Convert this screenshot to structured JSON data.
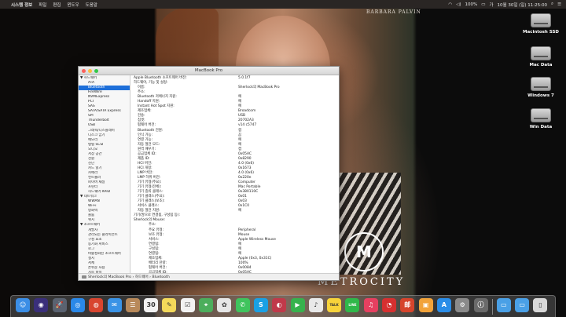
{
  "menubar": {
    "apple": "",
    "app_name": "시스템 정보",
    "menus": [
      "파일",
      "편집",
      "윈도우",
      "도움말"
    ],
    "battery": "100%",
    "datetime": "10월 30일 (일) 11:25:00"
  },
  "wallpaper": {
    "brand_text": "BARBARA PALVIN",
    "logo_text": "METROCITY",
    "logo_mark": "M"
  },
  "desktop_icons": [
    {
      "label": "Macintosh SSD"
    },
    {
      "label": "Mac Data"
    },
    {
      "label": "Windows 7"
    },
    {
      "label": "Win Data"
    }
  ],
  "window": {
    "title": "MacBook Pro",
    "sidebar": [
      {
        "label": "▼ 하드웨어",
        "type": "section"
      },
      {
        "label": "ATA",
        "type": "child"
      },
      {
        "label": "Bluetooth",
        "type": "child",
        "selected": true
      },
      {
        "label": "FireWire",
        "type": "child"
      },
      {
        "label": "NVMExpress",
        "type": "child"
      },
      {
        "label": "PCI",
        "type": "child"
      },
      {
        "label": "SAS",
        "type": "child"
      },
      {
        "label": "SATA/SATA Express",
        "type": "child"
      },
      {
        "label": "SPI",
        "type": "child"
      },
      {
        "label": "Thunderbolt",
        "type": "child"
      },
      {
        "label": "USB",
        "type": "child"
      },
      {
        "label": "그래픽/디스플레이",
        "type": "child"
      },
      {
        "label": "디스크 굽기",
        "type": "child"
      },
      {
        "label": "메모리",
        "type": "child"
      },
      {
        "label": "병렬 SCSI",
        "type": "child"
      },
      {
        "label": "오디오",
        "type": "child"
      },
      {
        "label": "저장 공간",
        "type": "child"
      },
      {
        "label": "전원",
        "type": "child"
      },
      {
        "label": "진단",
        "type": "child"
      },
      {
        "label": "카드 읽기",
        "type": "child"
      },
      {
        "label": "카메라",
        "type": "child"
      },
      {
        "label": "컨트롤러",
        "type": "child"
      },
      {
        "label": "파이버 채널",
        "type": "child"
      },
      {
        "label": "프린터",
        "type": "child"
      },
      {
        "label": "하드웨어 RAID",
        "type": "child"
      },
      {
        "label": "▼ 네트워크",
        "type": "section"
      },
      {
        "label": "WWAN",
        "type": "child"
      },
      {
        "label": "Wi-Fi",
        "type": "child"
      },
      {
        "label": "방화벽",
        "type": "child"
      },
      {
        "label": "볼륨",
        "type": "child"
      },
      {
        "label": "위치",
        "type": "child"
      },
      {
        "label": "▼ 소프트웨어",
        "type": "section"
      },
      {
        "label": "개발자",
        "type": "child"
      },
      {
        "label": "관리되는 클라이언트",
        "type": "child"
      },
      {
        "label": "구성 요소",
        "type": "child"
      },
      {
        "label": "동기화 서비스",
        "type": "child"
      },
      {
        "label": "로그",
        "type": "child"
      },
      {
        "label": "비활성화된 소프트웨어",
        "type": "child"
      },
      {
        "label": "설치",
        "type": "child"
      },
      {
        "label": "서체",
        "type": "child"
      },
      {
        "label": "손쉬운 사용",
        "type": "child"
      },
      {
        "label": "시동 항목",
        "type": "child"
      },
      {
        "label": "언어 및 지역",
        "type": "child"
      }
    ],
    "details": [
      {
        "indent": 0,
        "key": "Apple Bluetooth 소프트웨어 버전:",
        "value": "5.0.1f7"
      },
      {
        "indent": 0,
        "key": "하드웨어, 기능 및 설정:",
        "value": ""
      },
      {
        "indent": 1,
        "key": "이름:",
        "value": "Sherlock의 MacBook Pro"
      },
      {
        "indent": 1,
        "key": "주소:",
        "value": ""
      },
      {
        "indent": 1,
        "key": "Bluetooth 저에너지 지원:",
        "value": "예"
      },
      {
        "indent": 1,
        "key": "Handoff 지원:",
        "value": "예"
      },
      {
        "indent": 1,
        "key": "Instant Hot Spot 지원:",
        "value": "예"
      },
      {
        "indent": 1,
        "key": "제조업체:",
        "value": "Broadcom"
      },
      {
        "indent": 1,
        "key": "전송:",
        "value": "USB"
      },
      {
        "indent": 1,
        "key": "칩셋:",
        "value": "20702A3"
      },
      {
        "indent": 1,
        "key": "펌웨어 버전:",
        "value": "v14 c5747"
      },
      {
        "indent": 1,
        "key": "Bluetooth 전원:",
        "value": "켬"
      },
      {
        "indent": 1,
        "key": "인식 가능:",
        "value": "끔"
      },
      {
        "indent": 1,
        "key": "연결 가능:",
        "value": "예"
      },
      {
        "indent": 1,
        "key": "자동 절전 모드:",
        "value": "예"
      },
      {
        "indent": 1,
        "key": "원격 깨우기:",
        "value": "켬"
      },
      {
        "indent": 1,
        "key": "공급업체 ID:",
        "value": "0x05AC"
      },
      {
        "indent": 1,
        "key": "제품 ID:",
        "value": "0x8290"
      },
      {
        "indent": 1,
        "key": "HCI 버전:",
        "value": "4.0 (0x6)"
      },
      {
        "indent": 1,
        "key": "HCI 개정:",
        "value": "0x1673"
      },
      {
        "indent": 1,
        "key": "LMP 버전:",
        "value": "4.0 (0x6)"
      },
      {
        "indent": 1,
        "key": "LMP 하위 버전:",
        "value": "0x220e"
      },
      {
        "indent": 1,
        "key": "기기 유형(주요):",
        "value": "Computer"
      },
      {
        "indent": 1,
        "key": "기기 유형(전체):",
        "value": "Mac Portable"
      },
      {
        "indent": 1,
        "key": "기기 종류 클래스:",
        "value": "0x380110C"
      },
      {
        "indent": 1,
        "key": "기기 클래스(주요):",
        "value": "0x01"
      },
      {
        "indent": 1,
        "key": "기기 클래스(보조):",
        "value": "0x03"
      },
      {
        "indent": 1,
        "key": "서비스 클래스:",
        "value": "0x1C0"
      },
      {
        "indent": 1,
        "key": "자동 절전 지원:",
        "value": "예"
      },
      {
        "indent": 0,
        "key": "기기(쌍으로 연결됨, 구성됨 등):",
        "value": ""
      },
      {
        "indent": 0,
        "key": "Sherlock의 Mouse:",
        "value": ""
      },
      {
        "indent": 2,
        "key": "주소:",
        "value": ""
      },
      {
        "indent": 2,
        "key": "주요 유형:",
        "value": "Peripheral"
      },
      {
        "indent": 2,
        "key": "보조 유형:",
        "value": "Mouse"
      },
      {
        "indent": 2,
        "key": "서비스:",
        "value": "Apple Wireless Mouse"
      },
      {
        "indent": 2,
        "key": "연결됨:",
        "value": "예"
      },
      {
        "indent": 2,
        "key": "구성됨:",
        "value": "예"
      },
      {
        "indent": 2,
        "key": "연결됨:",
        "value": "예"
      },
      {
        "indent": 2,
        "key": "제조업체:",
        "value": "Apple (0x3, 0x31C)"
      },
      {
        "indent": 2,
        "key": "배터리 잔량:",
        "value": "100%"
      },
      {
        "indent": 2,
        "key": "펌웨어 버전:",
        "value": "0x0084"
      },
      {
        "indent": 2,
        "key": "공급업체 ID:",
        "value": "0x05AC"
      },
      {
        "indent": 2,
        "key": "제품 ID:",
        "value": "0x030D"
      },
      {
        "indent": 2,
        "key": "기기 클래스:",
        "value": "0x05 0x20 0x2580"
      },
      {
        "indent": 2,
        "key": "AFH:",
        "value": "켬"
      },
      {
        "indent": 2,
        "key": "AFH 맵:",
        "value": "300FFF300007C"
      },
      {
        "indent": 2,
        "key": "RSSI:",
        "value": "-57"
      },
      {
        "indent": 2,
        "key": "역할:",
        "value": "마스터"
      },
      {
        "indent": 2,
        "key": "연결 모드:",
        "value": "스니프 모드"
      },
      {
        "indent": 2,
        "key": "간격:",
        "value": "11.25 ms"
      },
      {
        "indent": 2,
        "key": "호스트 연결 지원:",
        "value": "예"
      }
    ],
    "pathbar": [
      "Sherlock의 MacBook Pro",
      "하드웨어",
      "Bluetooth"
    ]
  },
  "dock": {
    "apps": [
      {
        "name": "Finder",
        "glyph": "☺",
        "color": "#3b8ee6"
      },
      {
        "name": "Siri",
        "glyph": "◉",
        "color": "#3a2f7a"
      },
      {
        "name": "Launchpad",
        "glyph": "🚀",
        "color": "#5a6270"
      },
      {
        "name": "Safari",
        "glyph": "◎",
        "color": "#2a88e8"
      },
      {
        "name": "Chrome",
        "glyph": "◍",
        "color": "#d8452f"
      },
      {
        "name": "Mail",
        "glyph": "✉",
        "color": "#3a93e6"
      },
      {
        "name": "Contacts",
        "glyph": "☰",
        "color": "#b8895a"
      },
      {
        "name": "Calendar",
        "glyph": "30",
        "color": "#f2f2f2"
      },
      {
        "name": "Notes",
        "glyph": "✎",
        "color": "#f4d95a"
      },
      {
        "name": "Reminders",
        "glyph": "☑",
        "color": "#f2f2f2"
      },
      {
        "name": "Maps",
        "glyph": "⌖",
        "color": "#4cae5c"
      },
      {
        "name": "Photos",
        "glyph": "✿",
        "color": "#e6e6e6"
      },
      {
        "name": "Messages",
        "glyph": "✆",
        "color": "#3fc45d"
      },
      {
        "name": "Skype",
        "glyph": "S",
        "color": "#1aa0e4"
      },
      {
        "name": "Photo Booth",
        "glyph": "◐",
        "color": "#c0394a"
      },
      {
        "name": "FaceTime",
        "glyph": "▶",
        "color": "#37b24d"
      },
      {
        "name": "Music",
        "glyph": "♪",
        "color": "#e9e9e9"
      },
      {
        "name": "KakaoTalk",
        "glyph": "TALK",
        "color": "#f7d33a"
      },
      {
        "name": "LINE",
        "glyph": "LINE",
        "color": "#2fb84a"
      },
      {
        "name": "iTunes",
        "glyph": "♫",
        "color": "#e64060"
      },
      {
        "name": "NetEase Music",
        "glyph": "◔",
        "color": "#d63030"
      },
      {
        "name": "Mail App",
        "glyph": "邮",
        "color": "#d6452c"
      },
      {
        "name": "Books",
        "glyph": "▣",
        "color": "#f2a33a"
      },
      {
        "name": "App Store",
        "glyph": "A",
        "color": "#2a8de8"
      },
      {
        "name": "System Preferences",
        "glyph": "⚙",
        "color": "#8a8a8a"
      },
      {
        "name": "System Information",
        "glyph": "ⓘ",
        "color": "#6a6a6a"
      },
      {
        "name": "Applications Folder",
        "glyph": "▭",
        "color": "#4aa0e6"
      },
      {
        "name": "Downloads Folder",
        "glyph": "▭",
        "color": "#4aa0e6"
      },
      {
        "name": "Trash",
        "glyph": "▯",
        "color": "#d8d8d8"
      }
    ]
  }
}
